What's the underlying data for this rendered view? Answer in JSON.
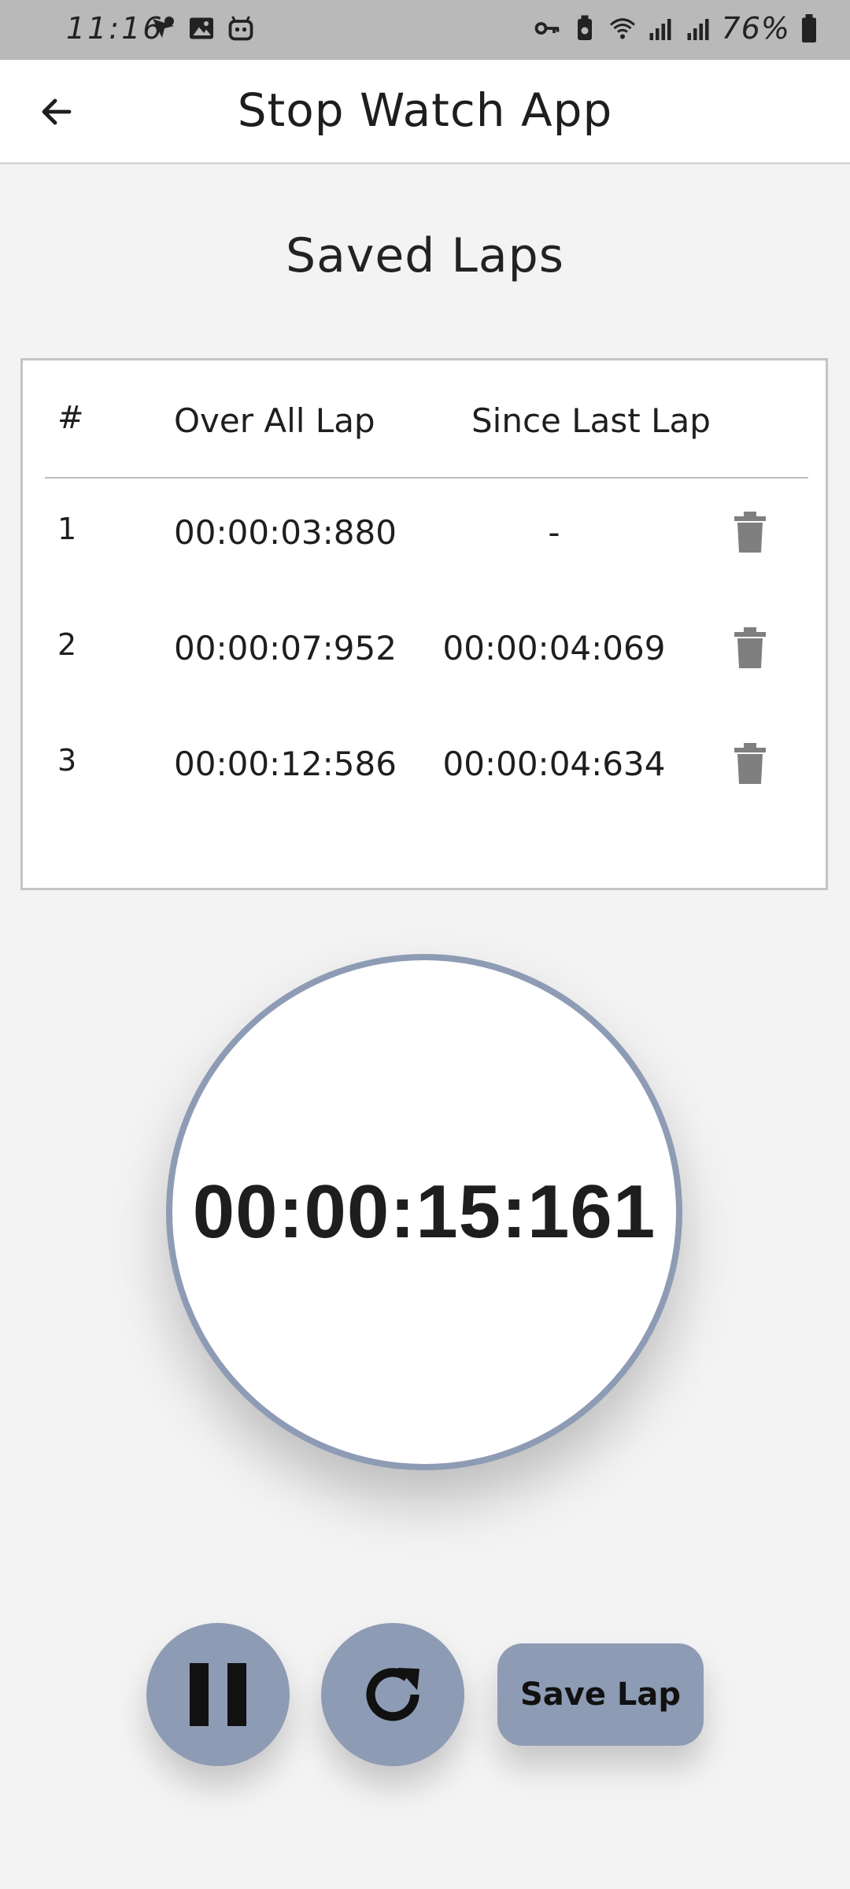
{
  "status_bar": {
    "time": "11:16",
    "battery": "76%"
  },
  "app_bar": {
    "title": "Stop Watch App"
  },
  "saved_laps": {
    "title": "Saved Laps",
    "columns": [
      "#",
      "Over All Lap",
      "Since Last Lap"
    ],
    "rows": [
      {
        "num": "1",
        "overall": "00:00:03:880",
        "since": "-"
      },
      {
        "num": "2",
        "overall": "00:00:07:952",
        "since": "00:00:04:069"
      },
      {
        "num": "3",
        "overall": "00:00:12:586",
        "since": "00:00:04:634"
      }
    ]
  },
  "stopwatch": {
    "time": "00:00:15:161"
  },
  "controls": {
    "pause_icon": "pause-icon",
    "reset_icon": "refresh-icon",
    "save_lap_label": "Save Lap"
  },
  "colors": {
    "accent": "#8e9bb4",
    "icon_gray": "#7f7f7f",
    "background": "#f3f3f4"
  }
}
